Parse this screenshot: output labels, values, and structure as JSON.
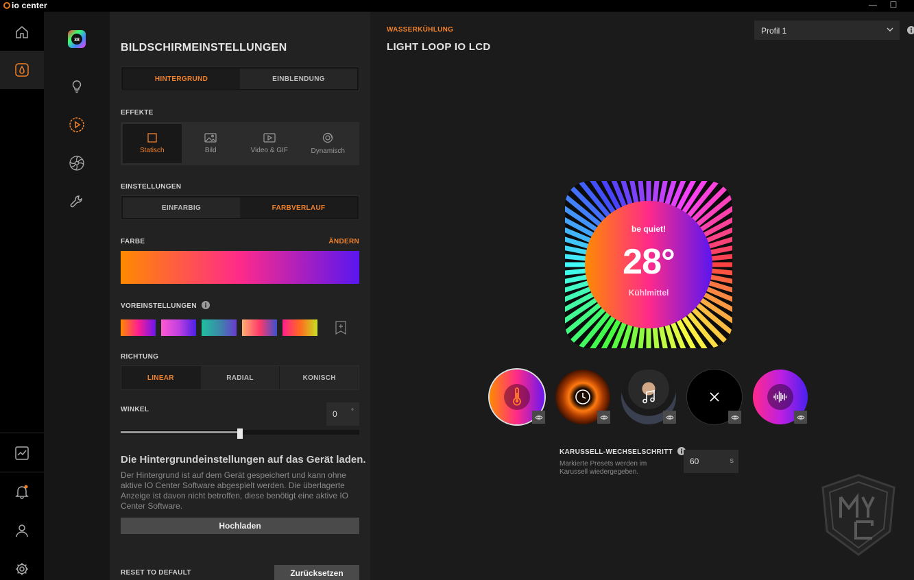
{
  "app": {
    "brand": "io center"
  },
  "window_controls": {
    "minimize": "—",
    "maximize": "☐"
  },
  "panel": {
    "title": "BILDSCHIRMEINSTELLUNGEN",
    "tabs": [
      {
        "label": "HINTERGRUND",
        "active": true
      },
      {
        "label": "EINBLENDUNG",
        "active": false
      }
    ],
    "effects_label": "EFFEKTE",
    "effects": [
      {
        "label": "Statisch",
        "icon": "square-icon",
        "active": true
      },
      {
        "label": "Bild",
        "icon": "image-icon",
        "active": false
      },
      {
        "label": "Video & GIF",
        "icon": "video-icon",
        "active": false
      },
      {
        "label": "Dynamisch",
        "icon": "dynamic-icon",
        "active": false
      }
    ],
    "settings_label": "EINSTELLUNGEN",
    "settings_options": [
      {
        "label": "EINFARBIG",
        "active": false
      },
      {
        "label": "FARBVERLAUF",
        "active": true
      }
    ],
    "color_label": "FARBE",
    "color_change": "ÄNDERN",
    "color_gradient": [
      "#ff8a00",
      "#ff2a8a",
      "#5a16f0"
    ],
    "presets_label": "VOREINSTELLUNGEN",
    "presets": [
      [
        "#ff8a00",
        "#ff1f8f",
        "#6a16f0"
      ],
      [
        "#ff5ad0",
        "#c040e0",
        "#4a20e8"
      ],
      [
        "#20c0a0",
        "#3a8aa8",
        "#6a3ad0"
      ],
      [
        "#ffb070",
        "#ff3a6a",
        "#3a50d0"
      ],
      [
        "#ff1f8f",
        "#ff6a20",
        "#c8e020"
      ]
    ],
    "direction_label": "RICHTUNG",
    "directions": [
      {
        "label": "LINEAR",
        "active": true
      },
      {
        "label": "RADIAL",
        "active": false
      },
      {
        "label": "KONISCH",
        "active": false
      }
    ],
    "angle_label": "WINKEL",
    "angle_value": "0",
    "angle_unit": "°",
    "angle_fraction": 0.5,
    "upload_title": "Die Hintergrundeinstellungen auf das Gerät laden.",
    "upload_desc": "Der Hintergrund ist auf dem Gerät gespeichert und kann ohne aktive IO Center Software abgespielt werden. Die überlagerte Anzeige ist davon nicht betroffen, diese benötigt eine aktive IO Center Software.",
    "upload_button": "Hochladen",
    "reset_label": "RESET TO DEFAULT",
    "reset_button": "Zurücksetzen"
  },
  "main": {
    "category": "WASSERKÜHLUNG",
    "device": "LIGHT LOOP IO LCD",
    "profile": "Profil 1",
    "lcd": {
      "brand": "be quiet!",
      "value": "28°",
      "caption": "Kühlmittel"
    },
    "carousel_presets": [
      {
        "name": "temperature",
        "icon": "thermometer-icon",
        "selected": true
      },
      {
        "name": "clock",
        "icon": "clock-icon",
        "selected": false
      },
      {
        "name": "music",
        "icon": "music-note-icon",
        "selected": false
      },
      {
        "name": "none",
        "icon": "x-icon",
        "selected": false
      },
      {
        "name": "audio",
        "icon": "soundwave-icon",
        "selected": false
      }
    ],
    "carousel_label": "KARUSSELL-WECHSELSCHRITT",
    "carousel_desc": "Markierte Presets werden im Karussell wiedergegeben.",
    "carousel_value": "60",
    "carousel_unit": "s"
  },
  "colors": {
    "accent": "#f0822b",
    "background": "#1b1b1b",
    "panel": "#222222",
    "rail": "#000000"
  }
}
